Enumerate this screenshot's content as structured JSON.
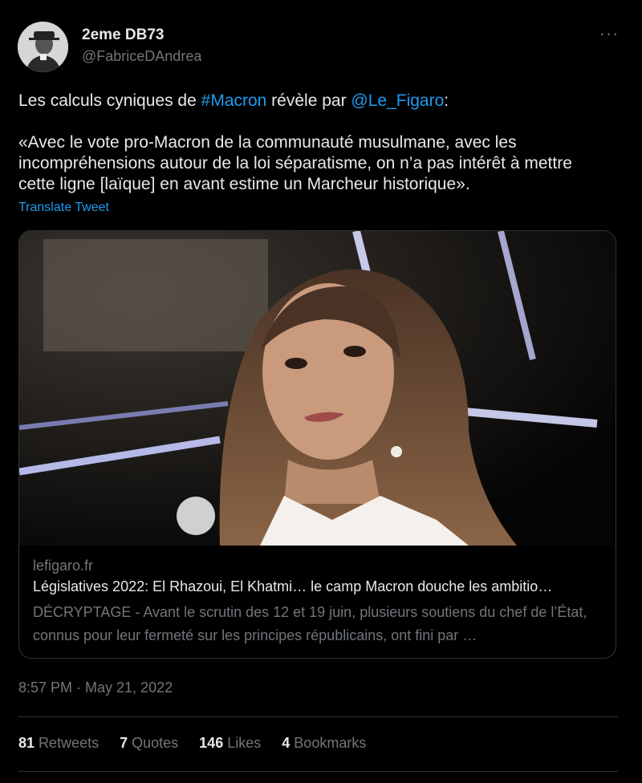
{
  "author": {
    "name": "2eme DB73",
    "handle": "@FabriceDAndrea"
  },
  "menu": {
    "more_label": "···"
  },
  "tweet": {
    "line1_prefix": "Les calculs cyniques de ",
    "hashtag": "#Macron",
    "line1_middle": " révèle par ",
    "mention": "@Le_Figaro",
    "line1_suffix": ":",
    "quote": "«Avec le vote pro-Macron de la communauté musulmane, avec les incompréhensions autour de la loi séparatisme, on n’a pas intérêt à mettre cette ligne [laïque] en avant estime un Marcheur historique».",
    "translate_label": "Translate Tweet"
  },
  "card": {
    "domain": "lefigaro.fr",
    "title": "Législatives 2022: El Rhazoui, El Khatmi… le camp Macron douche les ambitio…",
    "description": "DÉCRYPTAGE - Avant le scrutin des 12 et 19 juin, plusieurs soutiens du chef de l’État, connus pour leur fermeté sur les principes républicains, ont fini par …"
  },
  "timestamp": "8:57 PM · May 21, 2022",
  "stats": [
    {
      "count": "81",
      "label": "Retweets"
    },
    {
      "count": "7",
      "label": "Quotes"
    },
    {
      "count": "146",
      "label": "Likes"
    },
    {
      "count": "4",
      "label": "Bookmarks"
    }
  ]
}
